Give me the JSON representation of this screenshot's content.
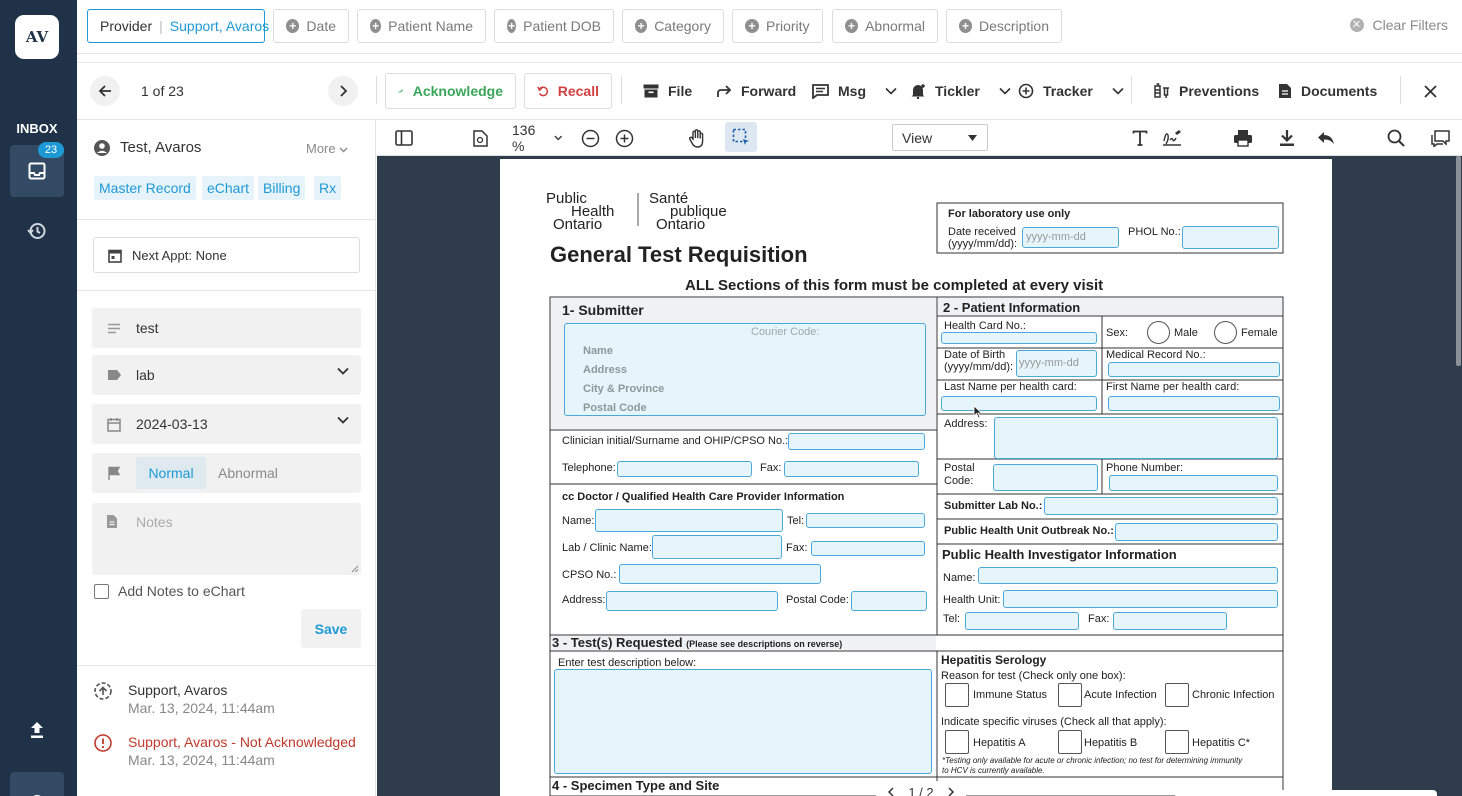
{
  "app": {
    "logo_text": "AV"
  },
  "sidebar": {
    "inbox_label": "INBOX",
    "inbox_badge": "23"
  },
  "filters": {
    "provider_label": "Provider",
    "provider_value": "Support, Avaros",
    "chips": [
      "Date",
      "Patient Name",
      "Patient DOB",
      "Category",
      "Priority",
      "Abnormal",
      "Description"
    ],
    "clear_label": "Clear Filters"
  },
  "toolbar": {
    "counter": "1 of 23",
    "acknowledge": "Acknowledge",
    "recall": "Recall",
    "file": "File",
    "forward": "Forward",
    "msg": "Msg",
    "tickler": "Tickler",
    "tracker": "Tracker",
    "preventions": "Preventions",
    "documents": "Documents"
  },
  "patient": {
    "name": "Test, Avaros",
    "more": "More",
    "tags": [
      "Master Record",
      "eChart",
      "Billing",
      "Rx"
    ],
    "next_appt": "Next Appt: None"
  },
  "form": {
    "description": "test",
    "category": "lab",
    "date": "2024-03-13",
    "normal": "Normal",
    "abnormal": "Abnormal",
    "notes_placeholder": "Notes",
    "add_notes_label": "Add Notes to eChart",
    "save": "Save"
  },
  "history": [
    {
      "name": "Support, Avaros",
      "status": "",
      "date": "Mar. 13, 2024, 11:44am"
    },
    {
      "name": "Support, Avaros",
      "status": " - Not Acknowledged",
      "date": "Mar. 13, 2024, 11:44am"
    }
  ],
  "viewer": {
    "zoom": "136 %",
    "view_mode": "View",
    "page_indicator": "1 / 2"
  },
  "document": {
    "org_en": [
      "Public",
      "Health",
      "Ontario"
    ],
    "org_fr": [
      "Santé",
      "publique",
      "Ontario"
    ],
    "lab_only": "For laboratory use only",
    "date_received": "Date received",
    "date_fmt": "(yyyy/mm/dd):",
    "date_ph": "yyyy-mm-dd",
    "phol": "PHOL No.:",
    "title": "General Test Requisition",
    "subtitle": "ALL Sections of this form must be completed at every visit",
    "sec1": "1- Submitter",
    "courier": "Courier Code:",
    "sub_name": "Name",
    "sub_address": "Address",
    "sub_city": "City & Province",
    "sub_postal": "Postal Code",
    "clinician": "Clinician initial/Surname and OHIP/CPSO No.:",
    "telephone": "Telephone:",
    "fax": "Fax:",
    "cc_title": "cc Doctor / Qualified Health Care Provider Information",
    "name": "Name:",
    "tel": "Tel:",
    "lab_clinic": "Lab / Clinic Name:",
    "cpso": "CPSO No.:",
    "address": "Address:",
    "postal_code": "Postal Code:",
    "sec2": "2 - Patient Information",
    "health_card": "Health Card No.:",
    "sex": "Sex:",
    "male": "Male",
    "female": "Female",
    "dob": "Date of Birth",
    "mrn": "Medical Record No.:",
    "last_name": "Last Name per health card:",
    "first_name": "First Name per health card:",
    "postal": "Postal",
    "code": "Code:",
    "phone": "Phone Number:",
    "submitter_lab": "Submitter Lab No.:",
    "outbreak": "Public Health Unit Outbreak No.:",
    "investigator": "Public Health Investigator Information",
    "health_unit": "Health Unit:",
    "tel2": "Tel:",
    "sec3": "3 - Test(s) Requested",
    "sec3_note": "(Please see descriptions on reverse)",
    "enter_test": "Enter test description below:",
    "hep": "Hepatitis Serology",
    "reason": "Reason for test (Check only one box):",
    "immune": "Immune Status",
    "acute": "Acute Infection",
    "chronic": "Chronic Infection",
    "indicate": "Indicate specific viruses (Check all that apply):",
    "hepa": "Hepatitis A",
    "hepb": "Hepatitis B",
    "hepc": "Hepatitis C*",
    "footnote1": "*Testing only available for acute or chronic infection; no test for determining immunity",
    "footnote2": "to HCV is currently available.",
    "sec4": "4 - Specimen Type and Site"
  }
}
